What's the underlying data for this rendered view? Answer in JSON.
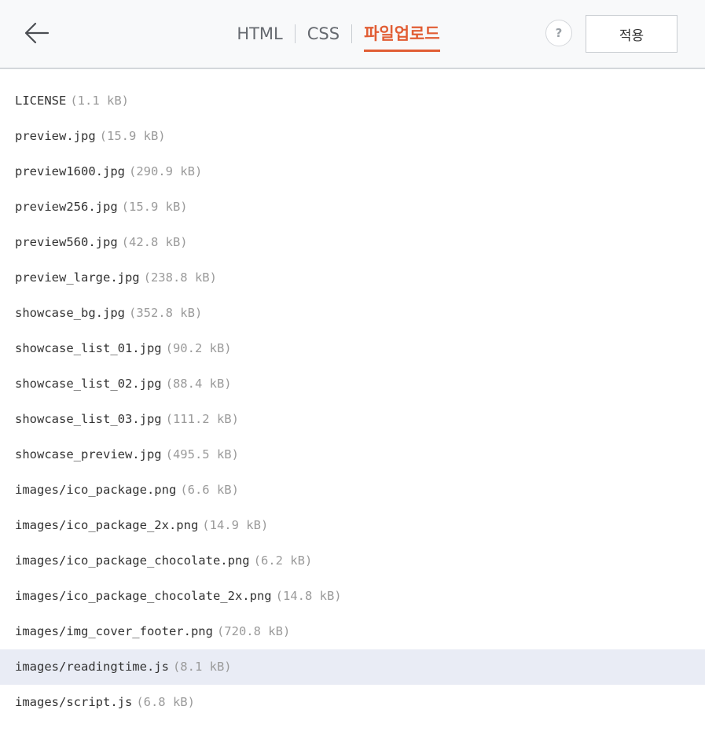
{
  "header": {
    "back_icon": "arrow-left-icon",
    "tabs": [
      {
        "label": "HTML",
        "active": false
      },
      {
        "label": "CSS",
        "active": false
      },
      {
        "label": "파일업로드",
        "active": true
      }
    ],
    "help_label": "?",
    "apply_label": "적용",
    "accent_color": "#e15d34"
  },
  "files": [
    {
      "name": "LICENSE",
      "size": "(1.1 kB)"
    },
    {
      "name": "preview.jpg",
      "size": "(15.9 kB)"
    },
    {
      "name": "preview1600.jpg",
      "size": "(290.9 kB)"
    },
    {
      "name": "preview256.jpg",
      "size": "(15.9 kB)"
    },
    {
      "name": "preview560.jpg",
      "size": "(42.8 kB)"
    },
    {
      "name": "preview_large.jpg",
      "size": "(238.8 kB)"
    },
    {
      "name": "showcase_bg.jpg",
      "size": "(352.8 kB)"
    },
    {
      "name": "showcase_list_01.jpg",
      "size": "(90.2 kB)"
    },
    {
      "name": "showcase_list_02.jpg",
      "size": "(88.4 kB)"
    },
    {
      "name": "showcase_list_03.jpg",
      "size": "(111.2 kB)"
    },
    {
      "name": "showcase_preview.jpg",
      "size": "(495.5 kB)"
    },
    {
      "name": "images/ico_package.png",
      "size": "(6.6 kB)"
    },
    {
      "name": "images/ico_package_2x.png",
      "size": "(14.9 kB)"
    },
    {
      "name": "images/ico_package_chocolate.png",
      "size": "(6.2 kB)"
    },
    {
      "name": "images/ico_package_chocolate_2x.png",
      "size": "(14.8 kB)"
    },
    {
      "name": "images/img_cover_footer.png",
      "size": "(720.8 kB)"
    },
    {
      "name": "images/readingtime.js",
      "size": "(8.1 kB)",
      "highlighted": true
    },
    {
      "name": "images/script.js",
      "size": "(6.8 kB)"
    }
  ]
}
